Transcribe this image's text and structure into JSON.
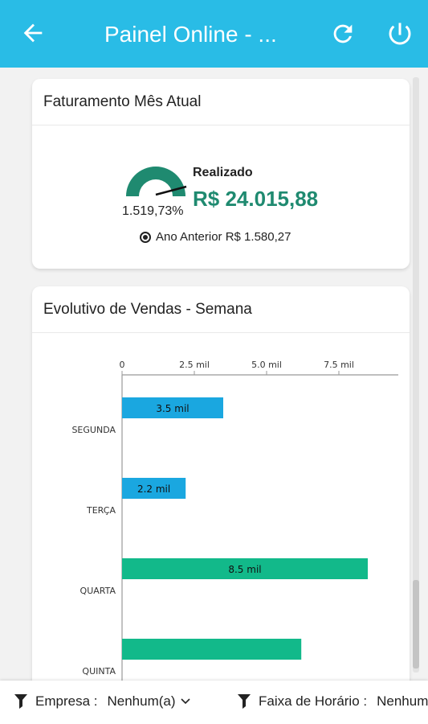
{
  "appbar": {
    "title": "Painel Online - ...",
    "back_icon": "arrow-back-icon",
    "refresh_icon": "refresh-icon",
    "power_icon": "power-icon",
    "color": "#29bce6"
  },
  "faturamento": {
    "title": "Faturamento Mês Atual",
    "gauge_percent": "1.519,73%",
    "realizado_label": "Realizado",
    "realizado_value": "R$ 24.015,88",
    "previous_label": "Ano Anterior R$ 1.580,27",
    "gauge_color": "#1f8a70",
    "value_color": "#1f8a70"
  },
  "evolutivo": {
    "title": "Evolutivo de Vendas - Semana"
  },
  "chart_data": {
    "type": "bar",
    "orientation": "horizontal",
    "categories": [
      "SEGUNDA",
      "TERÇA",
      "QUARTA",
      "QUINTA"
    ],
    "values": [
      3500,
      2200,
      8500,
      6200
    ],
    "labels": [
      "3.5 mil",
      "2.2 mil",
      "8.5 mil",
      ""
    ],
    "colors": [
      "#1aa7e0",
      "#1aa7e0",
      "#12b98a",
      "#12b98a"
    ],
    "x_ticks": [
      0,
      2500,
      5000,
      7500
    ],
    "x_tick_labels": [
      "0",
      "2.5 mil",
      "5.0 mil",
      "7.5 mil"
    ],
    "xlim": [
      0,
      9500
    ],
    "axis_position": "top"
  },
  "filters": {
    "empresa_label": "Empresa :",
    "empresa_value": "Nenhum(a)",
    "faixa_label": "Faixa de Horário :",
    "faixa_value": "Nenhum"
  }
}
